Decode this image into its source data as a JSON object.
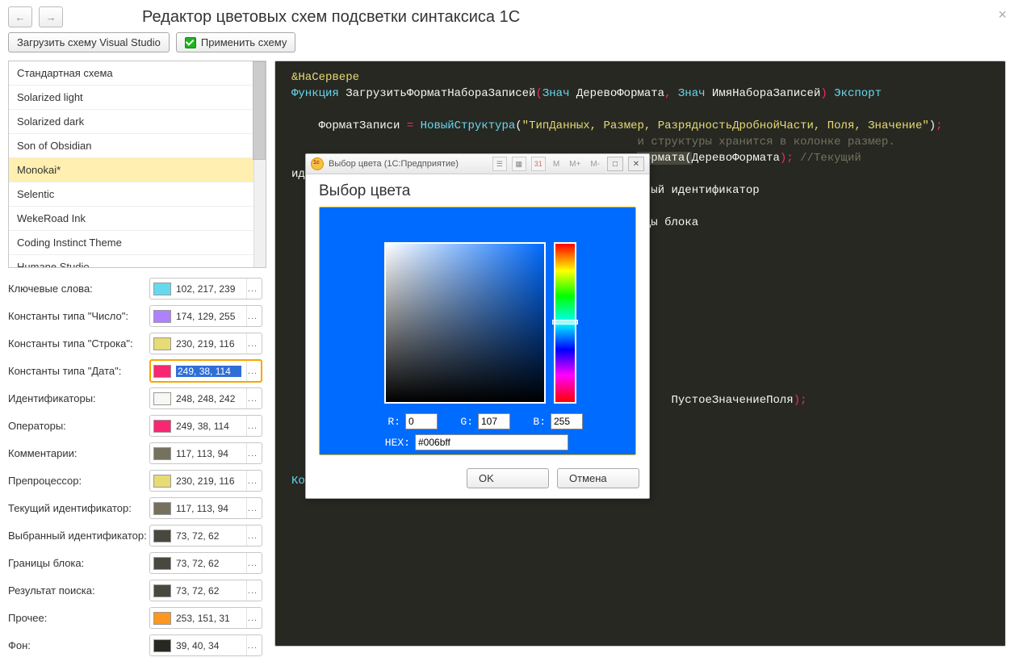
{
  "header": {
    "title": "Редактор цветовых схем подсветки синтаксиса 1С"
  },
  "toolbar": {
    "load_label": "Загрузить схему Visual Studio",
    "apply_label": "Применить схему"
  },
  "schemes": [
    "Стандартная схема",
    "Solarized light",
    "Solarized dark",
    "Son of Obsidian",
    "Monokai*",
    "Selentic",
    "WekeRoad Ink",
    "Coding Instinct Theme",
    "Humane Studio"
  ],
  "selected_scheme_index": 4,
  "color_rows": [
    {
      "label": "Ключевые слова:",
      "value": "102, 217, 239",
      "hex": "#66d9ef",
      "sel": false
    },
    {
      "label": "Константы типа \"Число\":",
      "value": "174, 129, 255",
      "hex": "#ae81ff",
      "sel": false
    },
    {
      "label": "Константы типа \"Строка\":",
      "value": "230, 219, 116",
      "hex": "#e6db74",
      "sel": false
    },
    {
      "label": "Константы типа \"Дата\":",
      "value": "249, 38, 114",
      "hex": "#f92672",
      "sel": true
    },
    {
      "label": "Идентификаторы:",
      "value": "248, 248, 242",
      "hex": "#f8f8f2",
      "sel": false
    },
    {
      "label": "Операторы:",
      "value": "249, 38, 114",
      "hex": "#f92672",
      "sel": false
    },
    {
      "label": "Комментарии:",
      "value": "117, 113, 94",
      "hex": "#75715e",
      "sel": false
    },
    {
      "label": "Препроцессор:",
      "value": "230, 219, 116",
      "hex": "#e6db74",
      "sel": false
    },
    {
      "label": "Текущий идентификатор:",
      "value": "117, 113, 94",
      "hex": "#75715e",
      "sel": false
    },
    {
      "label": "Выбранный идентификатор:",
      "value": "73, 72, 62",
      "hex": "#49483e",
      "sel": false
    },
    {
      "label": "Границы блока:",
      "value": "73, 72, 62",
      "hex": "#49483e",
      "sel": false
    },
    {
      "label": "Результат поиска:",
      "value": "73, 72, 62",
      "hex": "#49483e",
      "sel": false
    },
    {
      "label": "Прочее:",
      "value": "253, 151, 31",
      "hex": "#fd971f",
      "sel": false
    },
    {
      "label": "Фон:",
      "value": "39, 40, 34",
      "hex": "#272822",
      "sel": false
    }
  ],
  "dialog": {
    "window_title": "Выбор цвета (1С:Предприятие)",
    "heading": "Выбор цвета",
    "r_label": "R:",
    "g_label": "G:",
    "b_label": "B:",
    "hex_label": "HEX:",
    "r": "0",
    "g": "107",
    "b": "255",
    "hex": "#006bff",
    "btn_m": "M",
    "btn_mplus": "M+",
    "btn_mminus": "M-",
    "ok": "OK",
    "cancel": "Отмена"
  },
  "code": {
    "l1_dir": "&НаСервере",
    "l2_kw": "Функция",
    "l2_name": " ЗагрузитьФорматНабораЗаписей",
    "l2_p": "(",
    "l2_kw2": "Знач",
    "l2_a1": " ДеревоФормата",
    "l2_c": ",",
    "l2_kw3": " Знач",
    "l2_a2": " ИмяНабораЗаписей",
    "l2_p2": ") ",
    "l2_kw4": "Экспорт",
    "l4_a": "    ФорматЗаписи ",
    "l4_eq": "=",
    "l4_new": " НовыйСтруктура",
    "l4_p": "(",
    "l4_str": "\"ТипДанных, Размер, РазрядностьДробнойЧасти, Поля, Значение\"",
    "l4_p2": ")",
    "l4_sc": ";",
    "l5_cmt_tail": "и структуры хранится в колонке размер.",
    "l6_tail1": "Формата(",
    "l6_tail2": "ДеревоФормата",
    "l6_tail3": "); ",
    "l6_cmt": "//Текущий",
    "l7": "иде",
    "l8_tail": "нный идентификатор",
    "l9_tail": "ицы блока",
    "l14": "                                                        ПустоеЗначениеПоля",
    "l14_p": ")",
    "l14_sc": ";",
    "l17": "Кон"
  }
}
